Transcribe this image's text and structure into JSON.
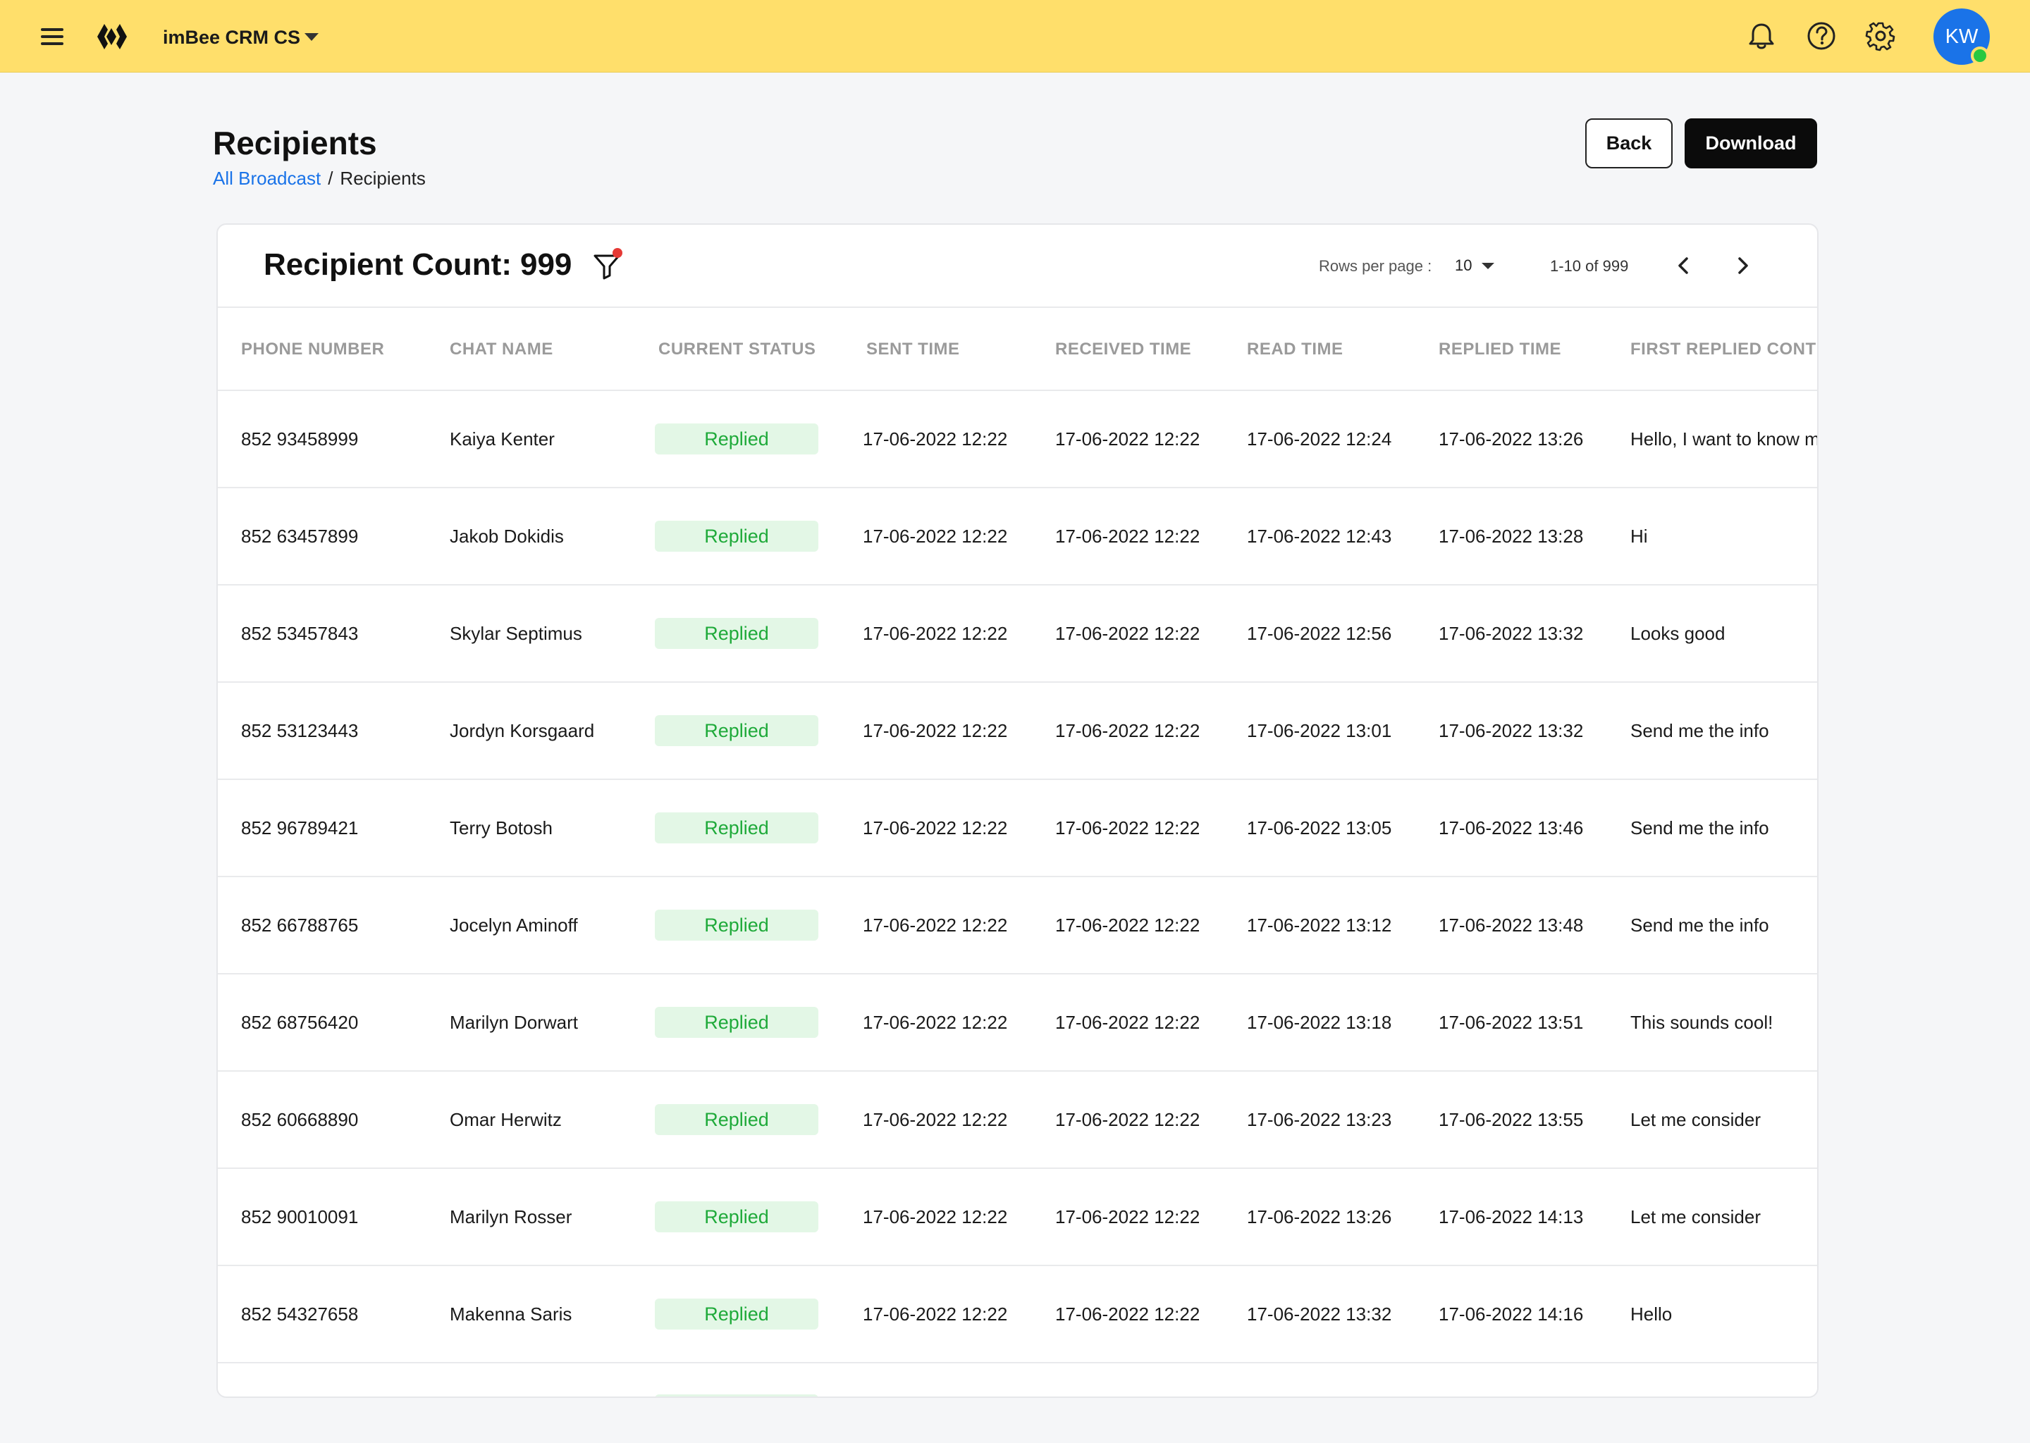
{
  "topbar": {
    "workspace_name": "imBee CRM CS",
    "avatar_initials": "KW",
    "icons": [
      "menu-icon",
      "imbee-logo",
      "bell-icon",
      "help-icon",
      "gear-icon"
    ]
  },
  "page": {
    "title": "Recipients",
    "breadcrumb": {
      "link": "All Broadcast",
      "separator": "/",
      "current": "Recipients"
    },
    "back_label": "Back",
    "download_label": "Download"
  },
  "card": {
    "count_label": "Recipient Count:",
    "count_value": "999",
    "rows_per_page_label": "Rows per page :",
    "rows_per_page_value": "10",
    "range_text": "1-10 of 999"
  },
  "table": {
    "columns": [
      "PHONE NUMBER",
      "CHAT NAME",
      "CURRENT STATUS",
      "SENT TIME",
      "RECEIVED TIME",
      "READ TIME",
      "REPLIED TIME",
      "FIRST REPLIED CONTE"
    ],
    "rows": [
      {
        "phone": "852 93458999",
        "chat": "Kaiya Kenter",
        "status": "Replied",
        "sent": "17-06-2022 12:22",
        "received": "17-06-2022 12:22",
        "read": "17-06-2022 12:24",
        "replied": "17-06-2022 13:26",
        "first": "Hello, I want to know m"
      },
      {
        "phone": "852 63457899",
        "chat": "Jakob Dokidis",
        "status": "Replied",
        "sent": "17-06-2022 12:22",
        "received": "17-06-2022 12:22",
        "read": "17-06-2022 12:43",
        "replied": "17-06-2022 13:28",
        "first": "Hi"
      },
      {
        "phone": "852 53457843",
        "chat": "Skylar Septimus",
        "status": "Replied",
        "sent": "17-06-2022 12:22",
        "received": "17-06-2022 12:22",
        "read": "17-06-2022 12:56",
        "replied": "17-06-2022 13:32",
        "first": "Looks good"
      },
      {
        "phone": "852 53123443",
        "chat": "Jordyn Korsgaard",
        "status": "Replied",
        "sent": "17-06-2022 12:22",
        "received": "17-06-2022 12:22",
        "read": "17-06-2022 13:01",
        "replied": "17-06-2022 13:32",
        "first": "Send me the info"
      },
      {
        "phone": "852 96789421",
        "chat": "Terry Botosh",
        "status": "Replied",
        "sent": "17-06-2022 12:22",
        "received": "17-06-2022 12:22",
        "read": "17-06-2022 13:05",
        "replied": "17-06-2022 13:46",
        "first": "Send me the info"
      },
      {
        "phone": "852 66788765",
        "chat": "Jocelyn Aminoff",
        "status": "Replied",
        "sent": "17-06-2022 12:22",
        "received": "17-06-2022 12:22",
        "read": "17-06-2022 13:12",
        "replied": "17-06-2022 13:48",
        "first": "Send me the info"
      },
      {
        "phone": "852 68756420",
        "chat": "Marilyn Dorwart",
        "status": "Replied",
        "sent": "17-06-2022 12:22",
        "received": "17-06-2022 12:22",
        "read": "17-06-2022 13:18",
        "replied": "17-06-2022 13:51",
        "first": "This sounds cool!"
      },
      {
        "phone": "852 60668890",
        "chat": "Omar Herwitz",
        "status": "Replied",
        "sent": "17-06-2022 12:22",
        "received": "17-06-2022 12:22",
        "read": "17-06-2022 13:23",
        "replied": "17-06-2022 13:55",
        "first": "Let me consider"
      },
      {
        "phone": "852 90010091",
        "chat": "Marilyn Rosser",
        "status": "Replied",
        "sent": "17-06-2022 12:22",
        "received": "17-06-2022 12:22",
        "read": "17-06-2022 13:26",
        "replied": "17-06-2022 14:13",
        "first": "Let me consider"
      },
      {
        "phone": "852 54327658",
        "chat": "Makenna Saris",
        "status": "Replied",
        "sent": "17-06-2022 12:22",
        "received": "17-06-2022 12:22",
        "read": "17-06-2022 13:32",
        "replied": "17-06-2022 14:16",
        "first": "Hello"
      }
    ]
  },
  "colors": {
    "topbar_bg": "#ffdf6b",
    "page_bg": "#f5f6f8",
    "link": "#1a73e8",
    "status_text": "#1faa3a",
    "status_bg": "#e3f7e6",
    "avatar_bg": "#1a73e8",
    "online": "#28c840",
    "filter_dot": "#e53935"
  }
}
